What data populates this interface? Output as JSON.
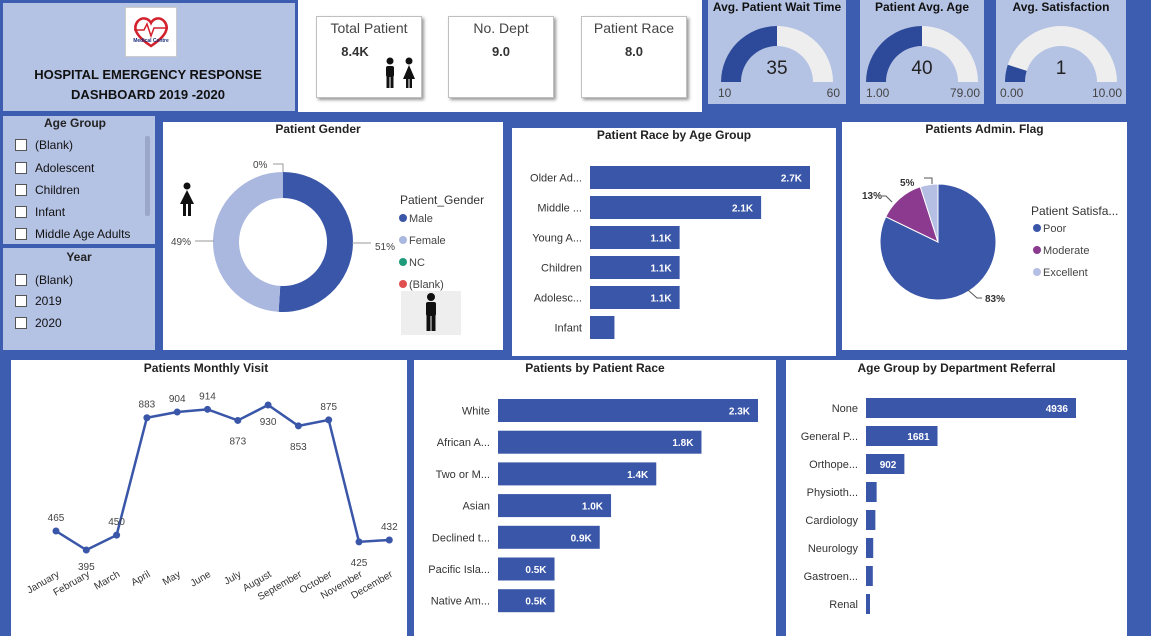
{
  "header": {
    "logo_text": "Medical Centre",
    "title_line1": "HOSPITAL EMERGENCY RESPONSE",
    "title_line2": "DASHBOARD 2019 -2020"
  },
  "kpis": [
    {
      "label": "Total Patient",
      "value": "8.4K"
    },
    {
      "label": "No. Dept",
      "value": "9.0"
    },
    {
      "label": "Patient Race",
      "value": "8.0"
    }
  ],
  "gauges": [
    {
      "title": "Avg. Patient Wait Time",
      "value": 35,
      "value_label": "35",
      "min": 10,
      "max": 60,
      "min_label": "10",
      "max_label": "60"
    },
    {
      "title": "Patient Avg. Age",
      "value": 40,
      "value_label": "40",
      "min": 1,
      "max": 79,
      "min_label": "1.00",
      "max_label": "79.00"
    },
    {
      "title": "Avg. Satisfaction",
      "value": 1,
      "value_label": "1",
      "min": 0,
      "max": 10,
      "min_label": "0.00",
      "max_label": "10.00"
    }
  ],
  "slicers": {
    "age_group": {
      "title": "Age Group",
      "items": [
        "(Blank)",
        "Adolescent",
        "Children",
        "Infant",
        "Middle Age Adults"
      ]
    },
    "year": {
      "title": "Year",
      "items": [
        "(Blank)",
        "2019",
        "2020"
      ]
    }
  },
  "colors": {
    "primary": "#3a56a8",
    "light": "#aab7df",
    "moderate": "#8b3a8f",
    "excellent": "#b5bfe3",
    "nc": "#1f9a7a",
    "blank": "#e05050",
    "background": "#3c5db0",
    "slicer_bg": "#b4c2e4"
  },
  "chart_data": [
    {
      "id": "gender",
      "type": "pie",
      "title": "Patient Gender",
      "legend_title": "Patient_Gender",
      "categories": [
        "Male",
        "Female",
        "NC",
        "(Blank)"
      ],
      "values": [
        51,
        49,
        0,
        0
      ],
      "labels": [
        "51%",
        "49%",
        "0%",
        ""
      ]
    },
    {
      "id": "race_age",
      "type": "bar",
      "orientation": "horizontal",
      "title": "Patient Race by Age Group",
      "categories": [
        "Older Ad...",
        "Middle ...",
        "Young A...",
        "Children",
        "Adolesc...",
        "Infant"
      ],
      "values": [
        2.7,
        2.1,
        1.1,
        1.1,
        1.1,
        0.3
      ],
      "labels": [
        "2.7K",
        "2.1K",
        "1.1K",
        "1.1K",
        "1.1K",
        ""
      ]
    },
    {
      "id": "admin_flag",
      "type": "pie",
      "title": "Patients Admin. Flag",
      "legend_title": "Patient Satisfa...",
      "categories": [
        "Poor",
        "Moderate",
        "Excellent"
      ],
      "values": [
        83,
        13,
        5
      ],
      "labels": [
        "83%",
        "13%",
        "5%"
      ]
    },
    {
      "id": "monthly",
      "type": "line",
      "title": "Patients Monthly Visit",
      "categories": [
        "January",
        "February",
        "March",
        "April",
        "May",
        "June",
        "July",
        "August",
        "September",
        "October",
        "November",
        "December"
      ],
      "values": [
        465,
        395,
        450,
        883,
        904,
        914,
        873,
        930,
        853,
        875,
        425,
        432
      ],
      "labels": [
        "465",
        "395",
        "450",
        "883",
        "904",
        "914",
        "873",
        "930",
        "853",
        "875",
        "425",
        "432"
      ]
    },
    {
      "id": "race",
      "type": "bar",
      "orientation": "horizontal",
      "title": "Patients by Patient Race",
      "categories": [
        "White",
        "African A...",
        "Two or M...",
        "Asian",
        "Declined t...",
        "Pacific Isla...",
        "Native Am..."
      ],
      "values": [
        2.3,
        1.8,
        1.4,
        1.0,
        0.9,
        0.5,
        0.5
      ],
      "labels": [
        "2.3K",
        "1.8K",
        "1.4K",
        "1.0K",
        "0.9K",
        "0.5K",
        "0.5K"
      ]
    },
    {
      "id": "dept",
      "type": "bar",
      "orientation": "horizontal",
      "title": "Age Group by Department Referral",
      "categories": [
        "None",
        "General P...",
        "Orthope...",
        "Physioth...",
        "Cardiology",
        "Neurology",
        "Gastroen...",
        "Renal"
      ],
      "values": [
        4936,
        1681,
        902,
        250,
        220,
        170,
        160,
        90
      ],
      "labels": [
        "4936",
        "1681",
        "902",
        "",
        "",
        "",
        "",
        ""
      ]
    }
  ]
}
